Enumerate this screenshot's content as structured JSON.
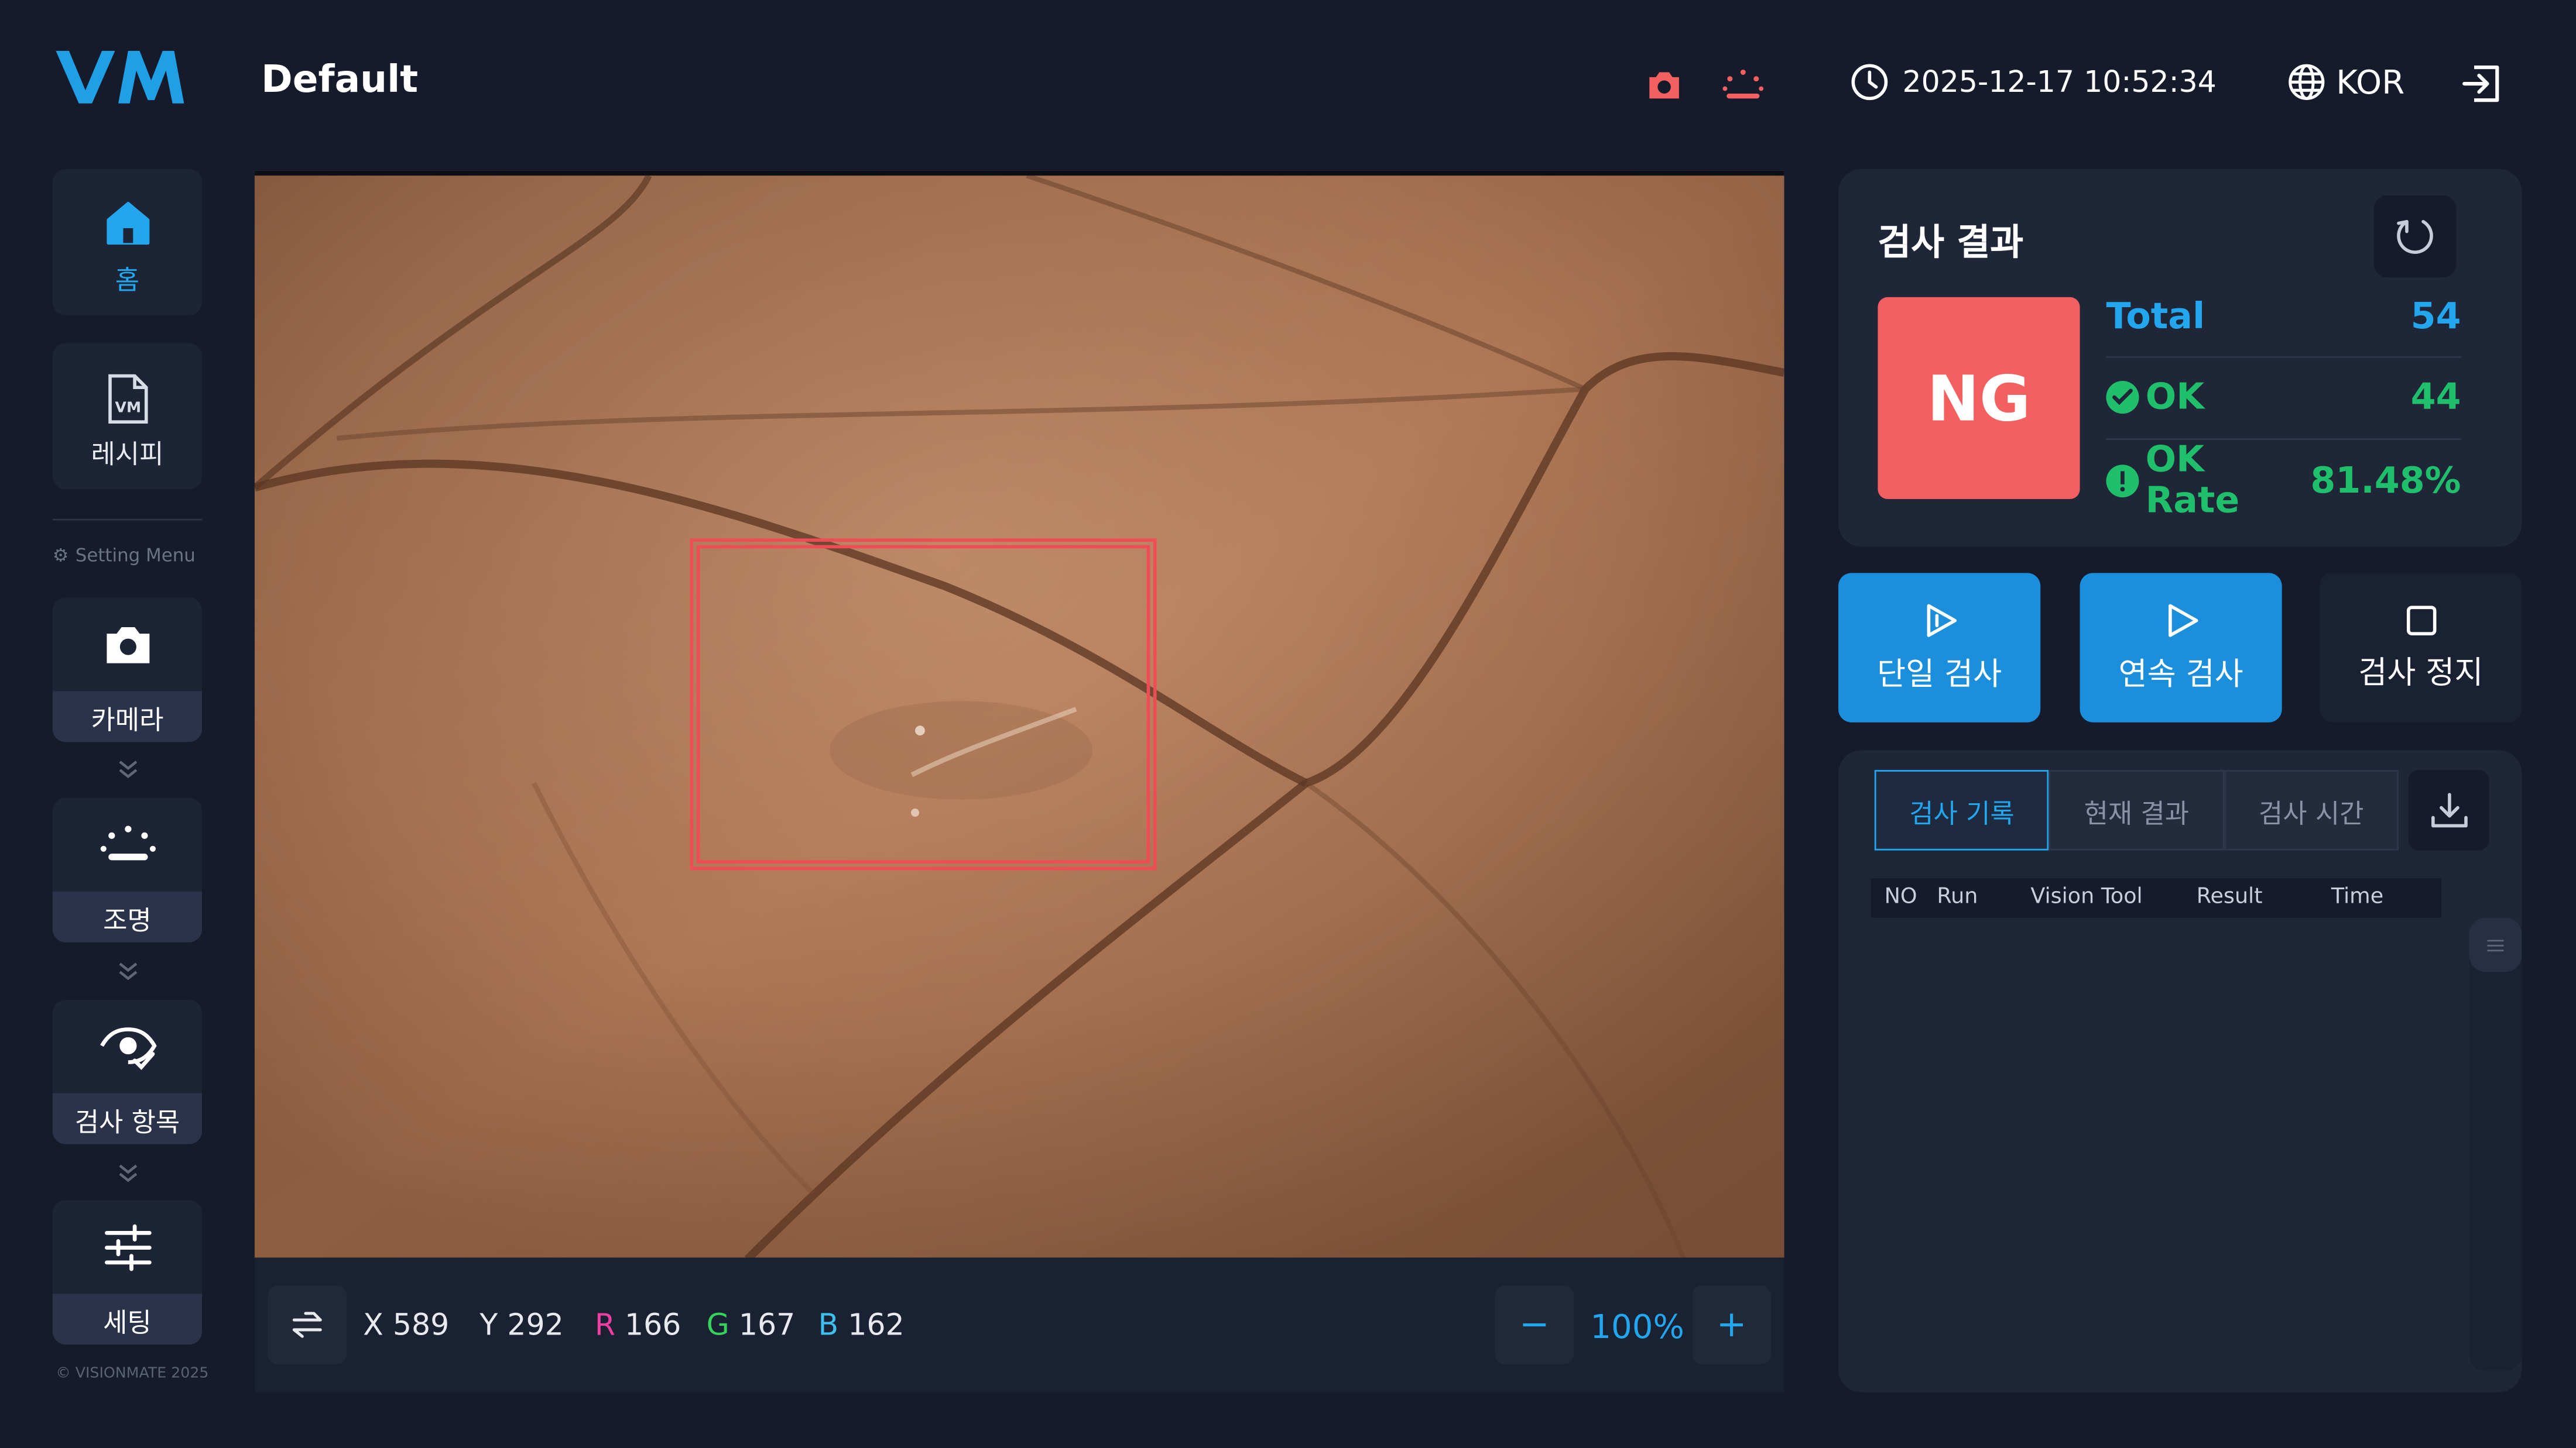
{
  "header": {
    "recipe_name": "Default",
    "datetime": "2025-12-17 10:52:34",
    "language": "KOR"
  },
  "brand": {
    "accent": "#22a7ee",
    "ng_color": "#f4605f",
    "ok_color": "#1fbf6b"
  },
  "sidebar": {
    "home_label": "홈",
    "recipe_label": "레시피",
    "setting_menu_label": "Setting Menu",
    "camera_label": "카메라",
    "light_label": "조명",
    "inspect_item_label": "검사 항목",
    "setting_label": "세팅",
    "copyright": "© VISIONMATE 2025"
  },
  "viewer": {
    "x_label": "X",
    "x_value": "589",
    "y_label": "Y",
    "y_value": "292",
    "r_label": "R",
    "r_value": "166",
    "g_label": "G",
    "g_value": "167",
    "b_label": "B",
    "b_value": "162",
    "zoom_minus": "−",
    "zoom_level": "100%",
    "zoom_plus": "+"
  },
  "result": {
    "title": "검사 결과",
    "status": "NG",
    "total_label": "Total",
    "total_value": "54",
    "ok_label": "OK",
    "ok_value": "44",
    "ok_rate_label": "OK Rate",
    "ok_rate_value": "81.48%"
  },
  "actions": {
    "single": "단일 검사",
    "continuous": "연속 검사",
    "stop": "검사 정지"
  },
  "records": {
    "tabs": [
      "검사 기록",
      "현재 결과",
      "검사 시간"
    ],
    "columns": [
      "NO",
      "Run",
      "Vision Tool",
      "Result",
      "Time"
    ]
  }
}
